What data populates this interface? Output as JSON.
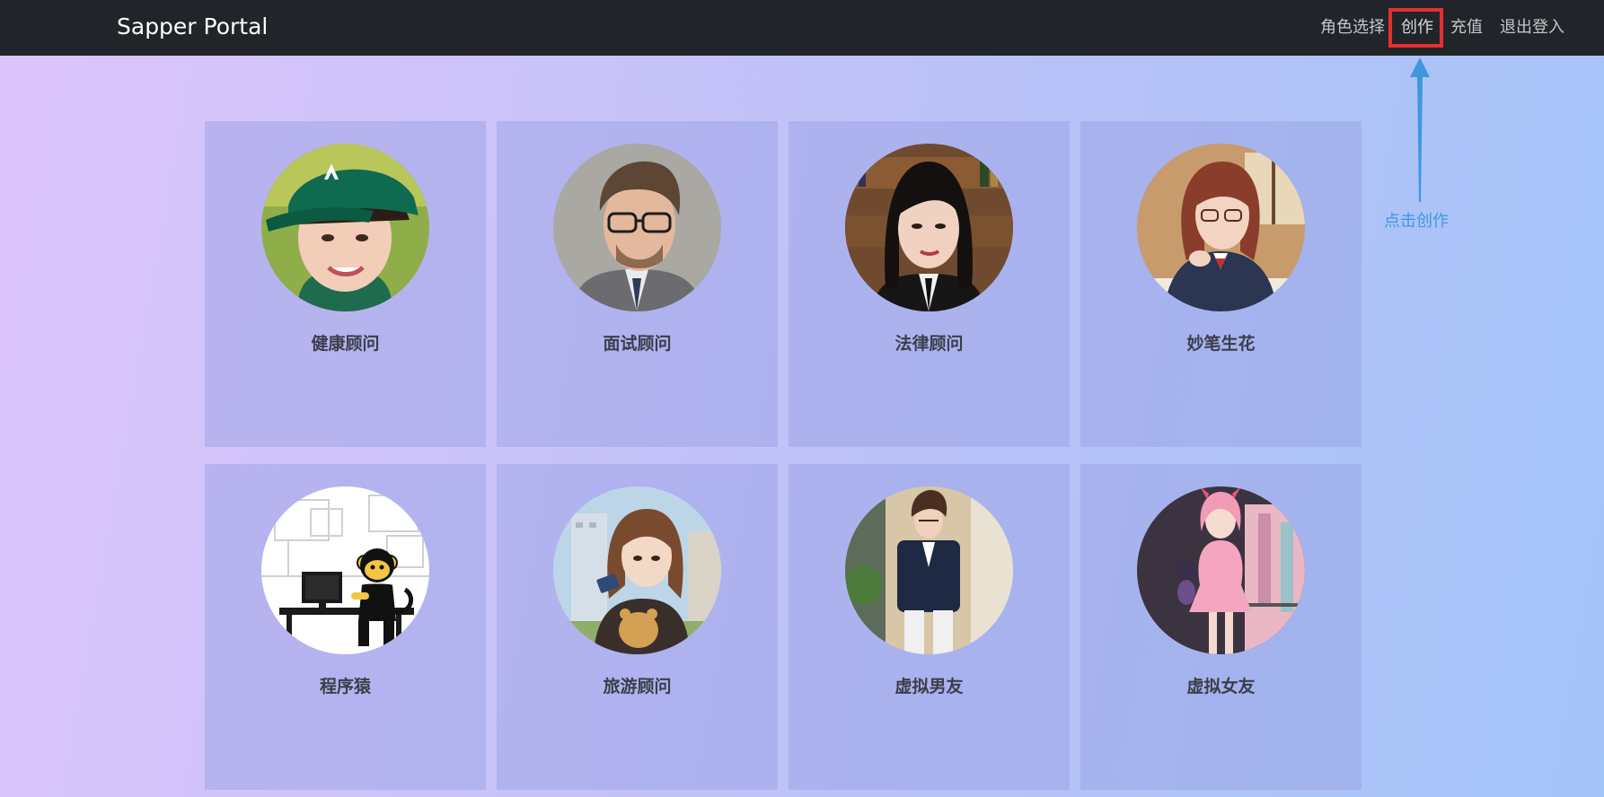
{
  "navbar": {
    "brand": "Sapper Portal",
    "links": [
      {
        "label": "角色选择"
      },
      {
        "label": "创作"
      },
      {
        "label": "充值"
      },
      {
        "label": "退出登入"
      }
    ]
  },
  "annotation": {
    "text": "点击创作",
    "highlight_color": "#e5302f",
    "arrow_color": "#3f97e0"
  },
  "cards": [
    {
      "title": "健康顾问",
      "icon": "avatar-health-advisor"
    },
    {
      "title": "面试顾问",
      "icon": "avatar-interview-advisor"
    },
    {
      "title": "法律顾问",
      "icon": "avatar-legal-advisor"
    },
    {
      "title": "妙笔生花",
      "icon": "avatar-writer"
    },
    {
      "title": "程序猿",
      "icon": "avatar-programmer-monkey"
    },
    {
      "title": "旅游顾问",
      "icon": "avatar-travel-advisor"
    },
    {
      "title": "虚拟男友",
      "icon": "avatar-virtual-boyfriend"
    },
    {
      "title": "虚拟女友",
      "icon": "avatar-virtual-girlfriend"
    }
  ],
  "colors": {
    "navbar_bg": "#212529",
    "nav_link": "#c3c6cb",
    "card_title": "#3b3e49"
  }
}
